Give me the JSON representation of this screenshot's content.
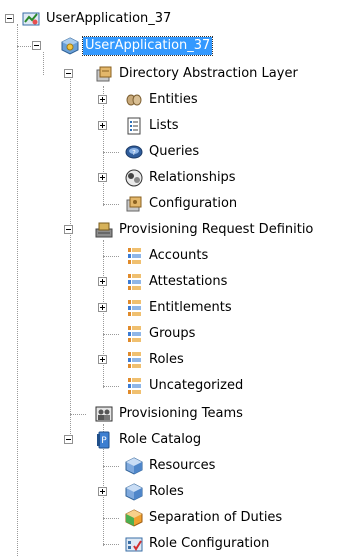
{
  "tree": {
    "root": "UserApplication_37",
    "app": "UserApplication_37",
    "dal": {
      "label": "Directory Abstraction Layer",
      "entities": "Entities",
      "lists": "Lists",
      "queries": "Queries",
      "relationships": "Relationships",
      "configuration": "Configuration"
    },
    "prd": {
      "label": "Provisioning Request Definitio",
      "accounts": "Accounts",
      "attestations": "Attestations",
      "entitlements": "Entitlements",
      "groups": "Groups",
      "roles": "Roles",
      "uncategorized": "Uncategorized"
    },
    "teams": "Provisioning Teams",
    "catalog": {
      "label": "Role Catalog",
      "resources": "Resources",
      "roles": "Roles",
      "sod": "Separation of Duties",
      "role_config": "Role Configuration"
    }
  },
  "colors": {
    "selection": "#3399ff",
    "connector": "#9a9a9a"
  }
}
